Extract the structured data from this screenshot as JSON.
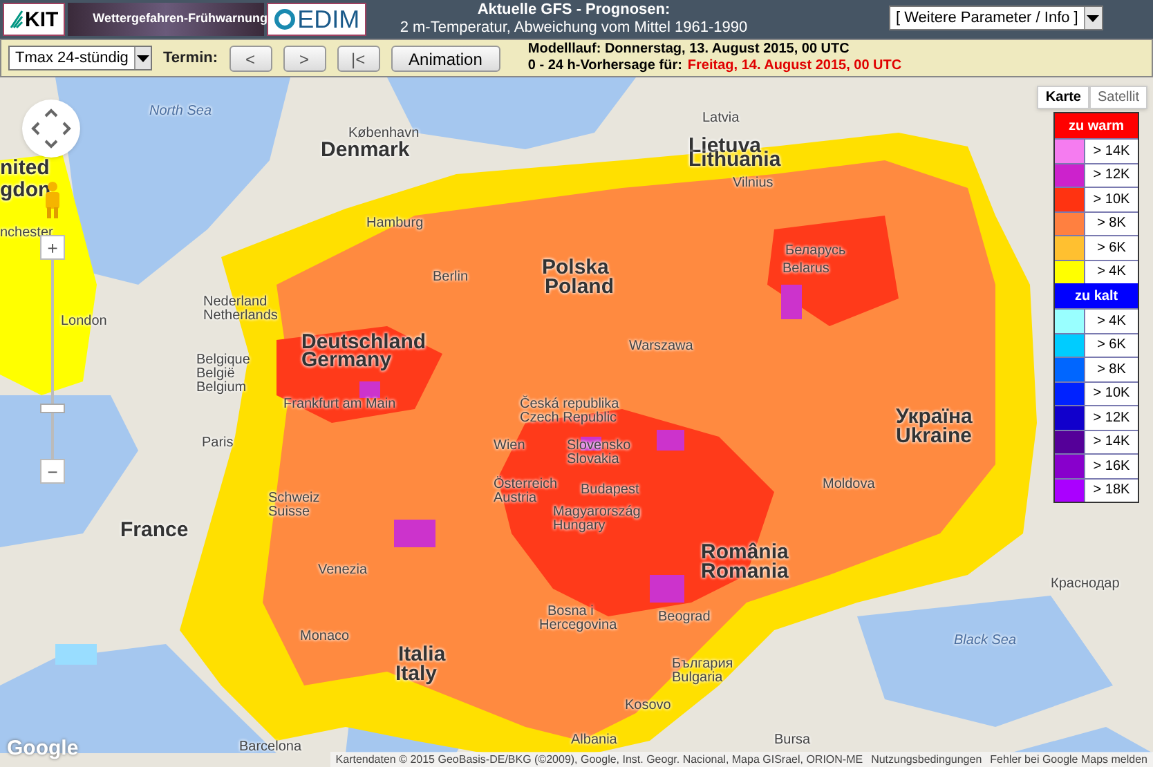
{
  "header": {
    "logos": [
      {
        "text": "KIT"
      },
      {
        "text": "Wettergefahren-Frühwarnung"
      },
      {
        "text": "EDIM"
      }
    ],
    "title_lines": [
      "Aktuelle GFS - Prognosen:",
      "2 m-Temperatur, Abweichung vom Mittel 1961-1990"
    ],
    "info_select": "[ Weitere Parameter / Info ]"
  },
  "toolbar": {
    "parameter_select": "Tmax 24-stündig",
    "termin_label": "Termin:",
    "buttons": [
      "<",
      ">",
      "|<",
      "Animation"
    ],
    "model_run": "Modelllauf: Donnerstag, 13. August 2015, 00 UTC",
    "forecast_label": "0 - 24 h-Vorhersage für:",
    "forecast_value": "Freitag, 14. August 2015, 00 UTC"
  },
  "map": {
    "map_types": [
      {
        "label": "Karte",
        "selected": true
      },
      {
        "label": "Satellit",
        "selected": false
      }
    ],
    "zoom_in": "+",
    "zoom_out": "−",
    "legend": [
      {
        "title": "zu warm",
        "color": "#ff0000",
        "items": [
          {
            "label": "> 14K",
            "color": "#f57cf0"
          },
          {
            "label": "> 12K",
            "color": "#cc22cc"
          },
          {
            "label": "> 10K",
            "color": "#ff3311"
          },
          {
            "label": "> 8K",
            "color": "#ff8040"
          },
          {
            "label": "> 6K",
            "color": "#ffc030"
          },
          {
            "label": "> 4K",
            "color": "#ffff00"
          }
        ]
      },
      {
        "title": "zu kalt",
        "color": "#0000ff",
        "items": [
          {
            "label": "> 4K",
            "color": "#99ffff"
          },
          {
            "label": "> 6K",
            "color": "#00ccff"
          },
          {
            "label": "> 8K",
            "color": "#0066ff"
          },
          {
            "label": "> 10K",
            "color": "#0022ff"
          },
          {
            "label": "> 12K",
            "color": "#1100cc"
          },
          {
            "label": "> 14K",
            "color": "#550099"
          },
          {
            "label": "> 16K",
            "color": "#8800cc"
          },
          {
            "label": "> 18K",
            "color": "#aa00ff"
          }
        ]
      }
    ],
    "labels": [
      {
        "text": "North Sea",
        "kind": "sea"
      },
      {
        "text": "København",
        "kind": "city"
      },
      {
        "text": "Denmark",
        "kind": "country"
      },
      {
        "text": "Latvia",
        "kind": "city"
      },
      {
        "text": "Lietuva",
        "kind": "country"
      },
      {
        "text": "Lithuania",
        "kind": "country"
      },
      {
        "text": "Vilnius",
        "kind": "city"
      },
      {
        "text": "Hamburg",
        "kind": "city"
      },
      {
        "text": "Berlin",
        "kind": "city"
      },
      {
        "text": "Polska",
        "kind": "country"
      },
      {
        "text": "Poland",
        "kind": "country"
      },
      {
        "text": "Warszawa",
        "kind": "city"
      },
      {
        "text": "Беларусь",
        "kind": "city"
      },
      {
        "text": "Belarus",
        "kind": "city"
      },
      {
        "text": "Deutschland",
        "kind": "country"
      },
      {
        "text": "Germany",
        "kind": "country"
      },
      {
        "text": "Nederland",
        "kind": "city"
      },
      {
        "text": "Netherlands",
        "kind": "city"
      },
      {
        "text": "Belgique",
        "kind": "city"
      },
      {
        "text": "België",
        "kind": "city"
      },
      {
        "text": "Belgium",
        "kind": "city"
      },
      {
        "text": "Frankfurt am Main",
        "kind": "city"
      },
      {
        "text": "Česká republika",
        "kind": "city"
      },
      {
        "text": "Czech Republic",
        "kind": "city"
      },
      {
        "text": "Slovensko",
        "kind": "city"
      },
      {
        "text": "Slovakia",
        "kind": "city"
      },
      {
        "text": "Wien",
        "kind": "city"
      },
      {
        "text": "Österreich",
        "kind": "city"
      },
      {
        "text": "Austria",
        "kind": "city"
      },
      {
        "text": "Budapest",
        "kind": "city"
      },
      {
        "text": "Magyarország",
        "kind": "city"
      },
      {
        "text": "Hungary",
        "kind": "city"
      },
      {
        "text": "Schweiz",
        "kind": "city"
      },
      {
        "text": "Suisse",
        "kind": "city"
      },
      {
        "text": "France",
        "kind": "country"
      },
      {
        "text": "London",
        "kind": "city"
      },
      {
        "text": "nited",
        "kind": "country"
      },
      {
        "text": "gdon",
        "kind": "country"
      },
      {
        "text": "nchester",
        "kind": "city"
      },
      {
        "text": "Україна",
        "kind": "country"
      },
      {
        "text": "Ukraine",
        "kind": "country"
      },
      {
        "text": "Moldova",
        "kind": "city"
      },
      {
        "text": "România",
        "kind": "country"
      },
      {
        "text": "Romania",
        "kind": "country"
      },
      {
        "text": "Beograd",
        "kind": "city"
      },
      {
        "text": "Bosna i",
        "kind": "city"
      },
      {
        "text": "Hercegovina",
        "kind": "city"
      },
      {
        "text": "Italia",
        "kind": "country"
      },
      {
        "text": "Italy",
        "kind": "country"
      },
      {
        "text": "Monaco",
        "kind": "city"
      },
      {
        "text": "Barcelona",
        "kind": "city"
      },
      {
        "text": "Black Sea",
        "kind": "sea"
      },
      {
        "text": "Краснодар",
        "kind": "city"
      },
      {
        "text": "Kosovo",
        "kind": "city"
      },
      {
        "text": "Albania",
        "kind": "city"
      },
      {
        "text": "Bursa",
        "kind": "city"
      },
      {
        "text": "България",
        "kind": "city"
      },
      {
        "text": "Bulgaria",
        "kind": "city"
      },
      {
        "text": "Venezia",
        "kind": "city"
      },
      {
        "text": "Paris",
        "kind": "city"
      }
    ],
    "google_logo": "Google",
    "footer": {
      "attribution": "Kartendaten © 2015 GeoBasis-DE/BKG (©2009), Google, Inst. Geogr. Nacional, Mapa GISrael, ORION-ME",
      "terms": "Nutzungsbedingungen",
      "report": "Fehler bei Google Maps melden"
    }
  }
}
